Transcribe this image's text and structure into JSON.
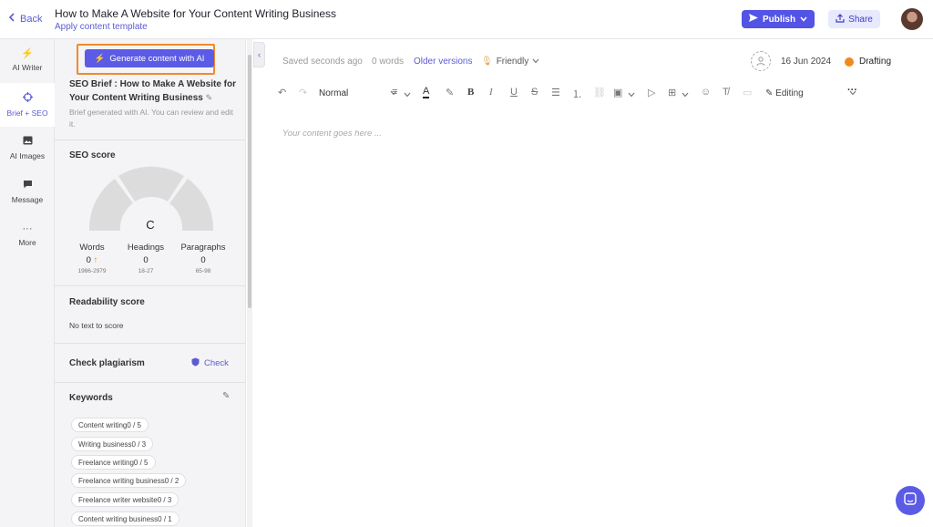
{
  "header": {
    "back_label": "Back",
    "title": "How to Make A Website for Your Content Writing Business",
    "subtitle": "Apply content template",
    "publish_label": "Publish",
    "share_label": "Share",
    "accent": "#5353e6"
  },
  "leftnav": {
    "items": [
      {
        "label": "AI Writer",
        "icon": "bolt-icon"
      },
      {
        "label": "Brief + SEO",
        "icon": "target-icon"
      },
      {
        "label": "AI Images",
        "icon": "image-icon"
      },
      {
        "label": "Message",
        "icon": "message-icon"
      },
      {
        "label": "More",
        "icon": "more-icon"
      }
    ],
    "active": "Brief + SEO"
  },
  "panel": {
    "generate_label": "Generate content with AI",
    "brief_title": "SEO Brief : How to Make A Website for Your Content Writing Business",
    "brief_note": "Brief generated with AI. You can review and edit it.",
    "seo_title": "SEO score",
    "seo_grade": "C",
    "stats": [
      {
        "label": "Words",
        "value": "0",
        "range": "1986-2979",
        "indicator": "up-arrow"
      },
      {
        "label": "Headings",
        "value": "0",
        "range": "18-27"
      },
      {
        "label": "Paragraphs",
        "value": "0",
        "range": "65-98"
      }
    ],
    "readability_title": "Readability score",
    "readability_text": "No text to score",
    "plagiarism_title": "Check plagiarism",
    "check_label": "Check",
    "keywords_title": "Keywords",
    "keywords": [
      {
        "name": "Content writing",
        "count": "0 / 5"
      },
      {
        "name": "Writing business",
        "count": "0 / 3"
      },
      {
        "name": "Freelance writing",
        "count": "0 / 5"
      },
      {
        "name": "Freelance writing business",
        "count": "0 / 2"
      },
      {
        "name": "Freelance writer website",
        "count": "0 / 3"
      },
      {
        "name": "Content writing business",
        "count": "0 / 1"
      }
    ]
  },
  "editor": {
    "saved_text": "Saved seconds ago",
    "word_count": "0 words",
    "older_versions": "Older versions",
    "tone": "Friendly",
    "date": "16 Jun 2024",
    "status": "Drafting",
    "status_color": "#f08a1e",
    "paragraph_style": "Normal",
    "mode": "Editing",
    "placeholder": "Your content goes here ..."
  }
}
